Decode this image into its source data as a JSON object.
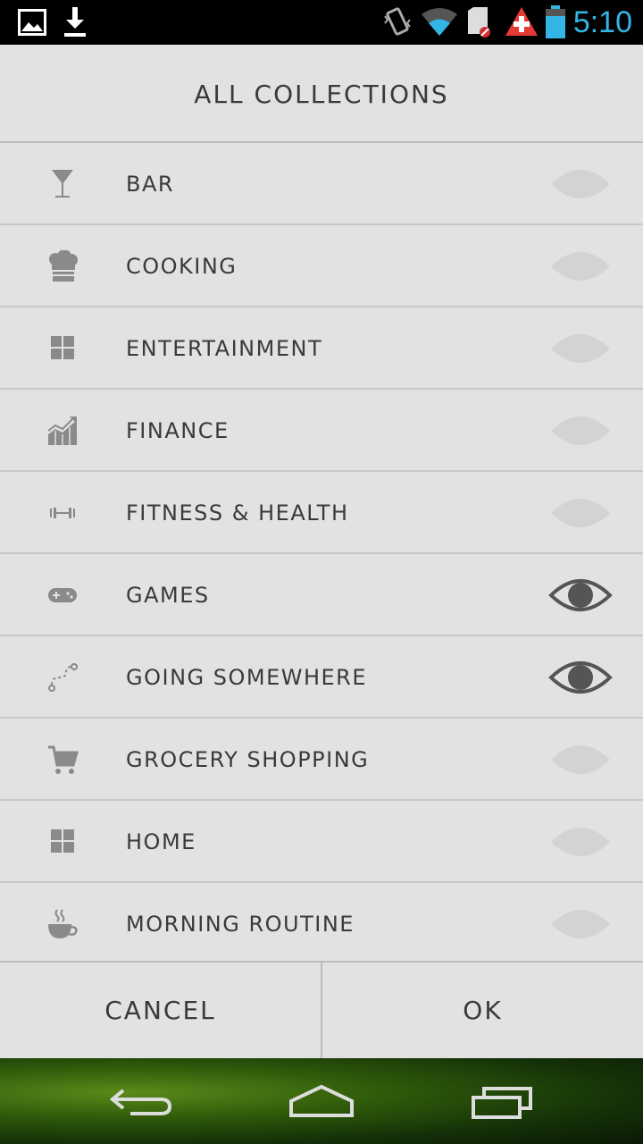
{
  "status_bar": {
    "time": "5:10",
    "icons": [
      "image-icon",
      "download-icon",
      "vibrate-icon",
      "wifi-icon",
      "sd-card-icon",
      "alert-icon",
      "battery-icon"
    ],
    "time_color": "#33b5e5"
  },
  "dialog": {
    "title": "ALL COLLECTIONS",
    "items": [
      {
        "label": "BAR",
        "icon": "cocktail-glass-icon",
        "visible": false
      },
      {
        "label": "COOKING",
        "icon": "chef-hat-icon",
        "visible": false
      },
      {
        "label": "ENTERTAINMENT",
        "icon": "grid-icon",
        "visible": false
      },
      {
        "label": "FINANCE",
        "icon": "chart-growth-icon",
        "visible": false
      },
      {
        "label": "FITNESS & HEALTH",
        "icon": "dumbbell-icon",
        "visible": false
      },
      {
        "label": "GAMES",
        "icon": "gamepad-icon",
        "visible": true
      },
      {
        "label": "GOING SOMEWHERE",
        "icon": "route-icon",
        "visible": true
      },
      {
        "label": "GROCERY SHOPPING",
        "icon": "cart-icon",
        "visible": false
      },
      {
        "label": "HOME",
        "icon": "grid-icon",
        "visible": false
      },
      {
        "label": "MORNING ROUTINE",
        "icon": "coffee-cup-icon",
        "visible": false
      }
    ],
    "cancel_label": "CANCEL",
    "ok_label": "OK"
  },
  "nav_bar": {
    "icons": [
      "back-icon",
      "home-icon",
      "recent-apps-icon"
    ]
  }
}
